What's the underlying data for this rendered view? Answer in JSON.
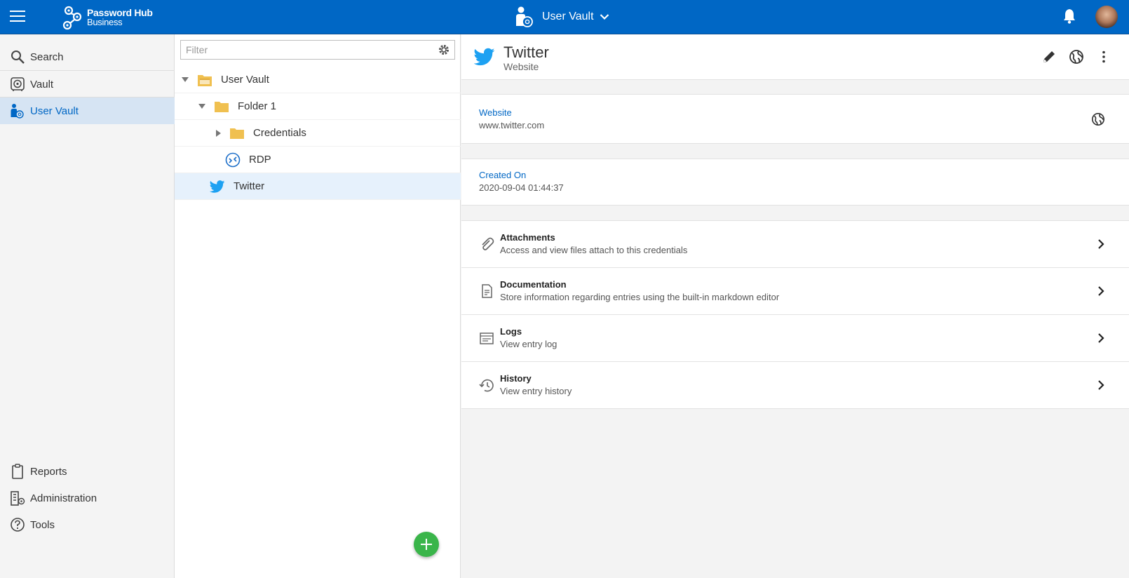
{
  "header": {
    "brand_line1": "Password Hub",
    "brand_line2": "Business",
    "vault_title": "User Vault"
  },
  "sidebar": {
    "top_items": [
      {
        "label": "Search",
        "icon": "search-icon"
      },
      {
        "label": "Vault",
        "icon": "vault-icon"
      },
      {
        "label": "User Vault",
        "icon": "user-vault-icon",
        "active": true
      }
    ],
    "bottom_items": [
      {
        "label": "Reports",
        "icon": "clipboard-icon"
      },
      {
        "label": "Administration",
        "icon": "building-icon"
      },
      {
        "label": "Tools",
        "icon": "help-circle-icon"
      }
    ]
  },
  "tree": {
    "filter_placeholder": "Filter",
    "rows": [
      {
        "label": "User Vault",
        "type": "root-folder",
        "expanded": true
      },
      {
        "label": "Folder 1",
        "type": "folder",
        "expanded": true
      },
      {
        "label": "Credentials",
        "type": "folder",
        "expanded": false
      },
      {
        "label": "RDP",
        "type": "rdp"
      },
      {
        "label": "Twitter",
        "type": "twitter",
        "selected": true
      }
    ]
  },
  "detail": {
    "title": "Twitter",
    "subtitle": "Website",
    "fields": [
      {
        "label": "Website",
        "value": "www.twitter.com"
      },
      {
        "label": "Created On",
        "value": "2020-09-04 01:44:37"
      }
    ],
    "links": [
      {
        "title": "Attachments",
        "desc": "Access and view files attach to this credentials",
        "icon": "paperclip-icon"
      },
      {
        "title": "Documentation",
        "desc": "Store information regarding entries using the built-in markdown editor",
        "icon": "document-icon"
      },
      {
        "title": "Logs",
        "desc": "View entry log",
        "icon": "log-icon"
      },
      {
        "title": "History",
        "desc": "View entry history",
        "icon": "history-icon"
      }
    ]
  },
  "colors": {
    "brand_blue": "#0067c5",
    "twitter_blue": "#1da1f2",
    "folder_yellow": "#f0c050",
    "add_green": "#3ab54a"
  }
}
